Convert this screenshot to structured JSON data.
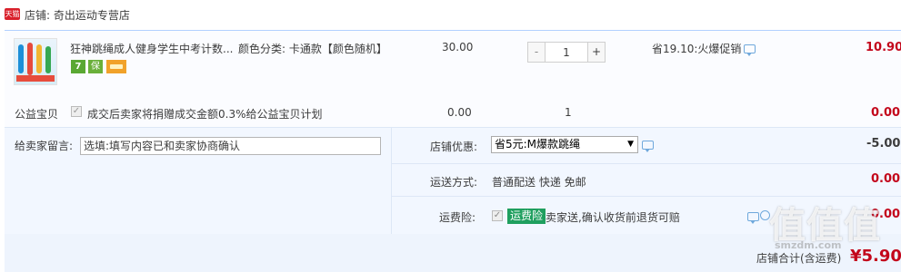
{
  "shop": {
    "badge": "天猫",
    "name": "店铺: 奇出运动专营店"
  },
  "item": {
    "title": "狂神跳绳成人健身学生中考计数...",
    "sku": "颜色分类: 卡通款【颜色随机】",
    "badges": [
      "7",
      "保",
      "卡"
    ],
    "price": "30.00",
    "quantity": "1",
    "minus": "-",
    "plus": "+",
    "promo": "省19.10:火爆促销",
    "subtotal": "10.90"
  },
  "charity": {
    "label": "公益宝贝",
    "text": "成交后卖家将捐赠成交金额0.3%给公益宝贝计划",
    "price": "0.00",
    "quantity": "1",
    "subtotal": "0.00"
  },
  "message": {
    "label": "给卖家留言:",
    "placeholder": "选填:填写内容已和卖家协商确认"
  },
  "coupon": {
    "label": "店铺优惠:",
    "selected": "省5元:M爆款跳绳",
    "amount": "-5.00"
  },
  "shipping": {
    "label": "运送方式:",
    "method": "普通配送 快递 免邮",
    "amount": "0.00"
  },
  "insurance": {
    "label": "运费险:",
    "badge": "运费险",
    "desc": "卖家送,确认收货前退货可赔",
    "amount": "0.00"
  },
  "total": {
    "label": "店铺合计(含运费)",
    "value": "¥5.90"
  },
  "watermark": {
    "main": "值值值",
    "sub": "smzdm.com"
  },
  "colors": {
    "price_red": "#c3061b",
    "tmall_red": "#d9202b",
    "panel_bg": "#f2f7ff",
    "insurance_green": "#1f9f5f"
  },
  "icons": [
    "tmall-icon",
    "chat-icon",
    "checkbox-icon",
    "dropdown-caret-icon"
  ]
}
